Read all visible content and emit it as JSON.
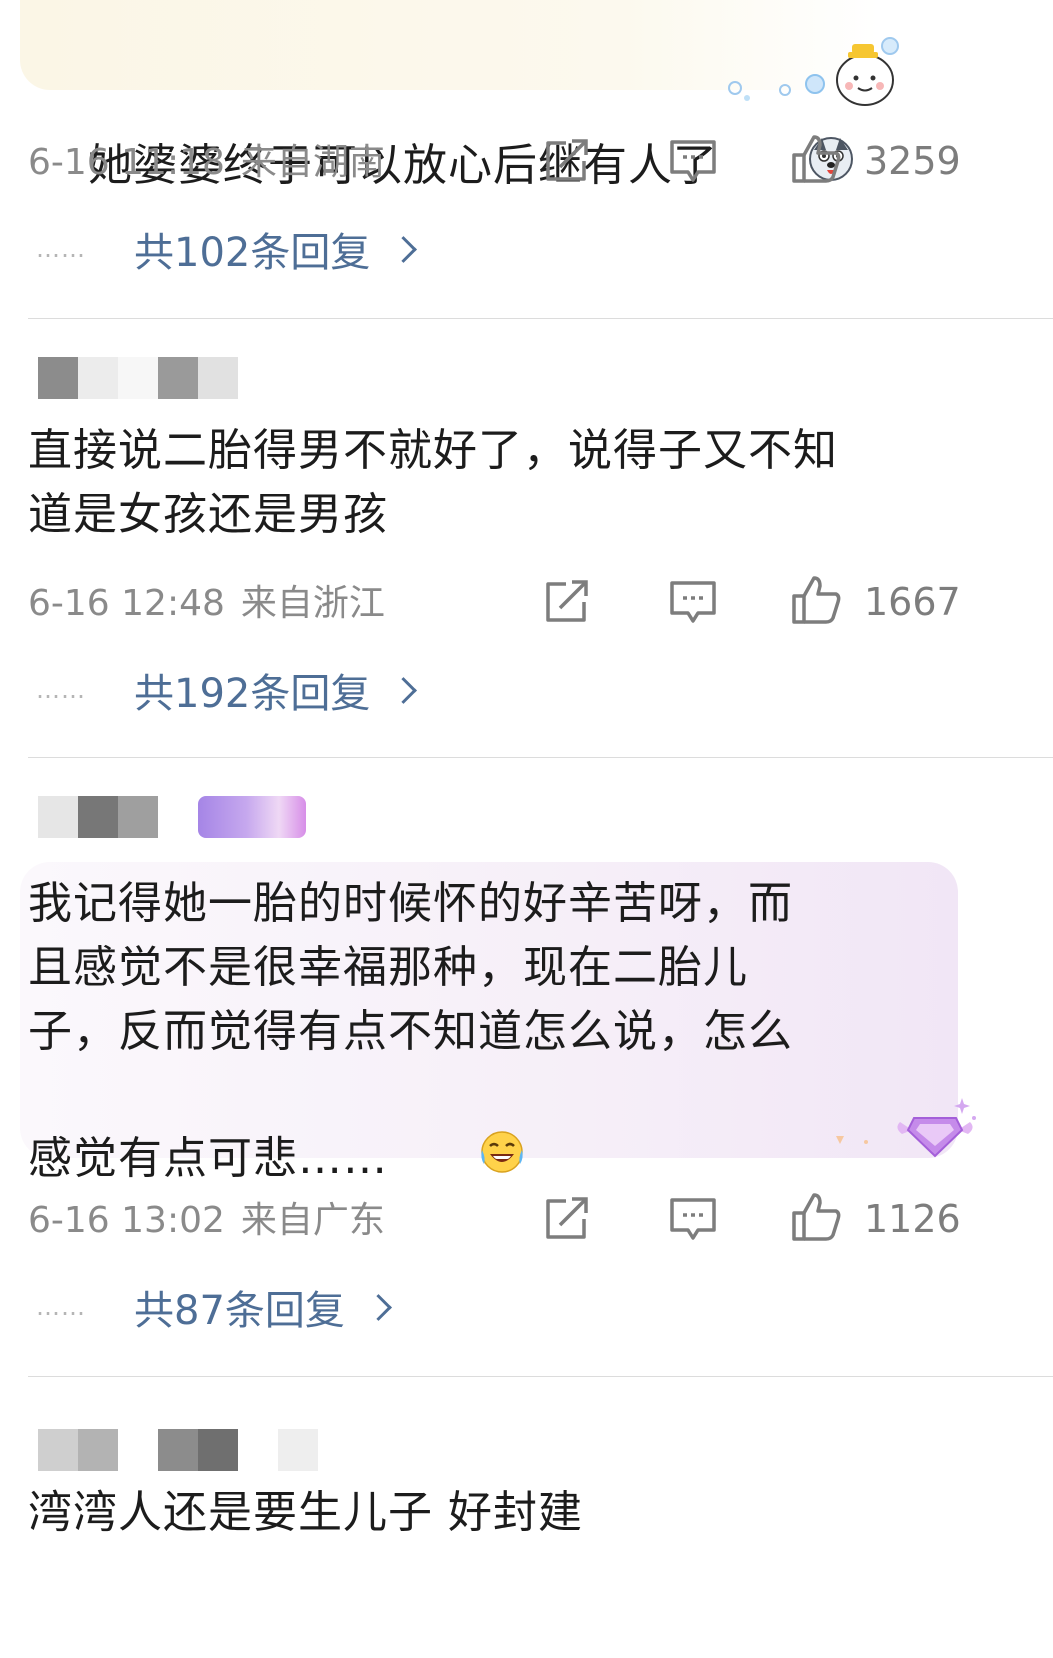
{
  "comments": [
    {
      "text": "她婆婆终于可以放心后继有人了",
      "emoji": "dog-face-emoji",
      "date": "6-16 11:18",
      "location": "来自湖南",
      "likes": "3259",
      "replies": "共102条回复"
    },
    {
      "text": "直接说二胎得男不就好了，说得子又不知\n道是女孩还是男孩",
      "date": "6-16 12:48",
      "location": "来自浙江",
      "likes": "1667",
      "replies": "共192条回复"
    },
    {
      "text": "我记得她一胎的时候怀的好辛苦呀，而\n且感觉不是很幸福那种，现在二胎儿\n子，反而觉得有点不知道怎么说，怎么\n感觉有点可悲……",
      "emoji": "tears-of-joy-emoji",
      "date": "6-16 13:02",
      "location": "来自广东",
      "likes": "1126",
      "replies": "共87条回复"
    },
    {
      "text": "湾湾人还是要生儿子 好封建"
    }
  ],
  "reply_dots": "……",
  "icons": {
    "share": "share-icon",
    "comment": "comment-icon",
    "like": "like-icon",
    "chevron": "chevron-right-icon",
    "vip": "vip-diamond-icon"
  },
  "colors": {
    "meta": "#8a8a8a",
    "reply_link": "#4e6e96",
    "divider": "#dcdcdc"
  }
}
